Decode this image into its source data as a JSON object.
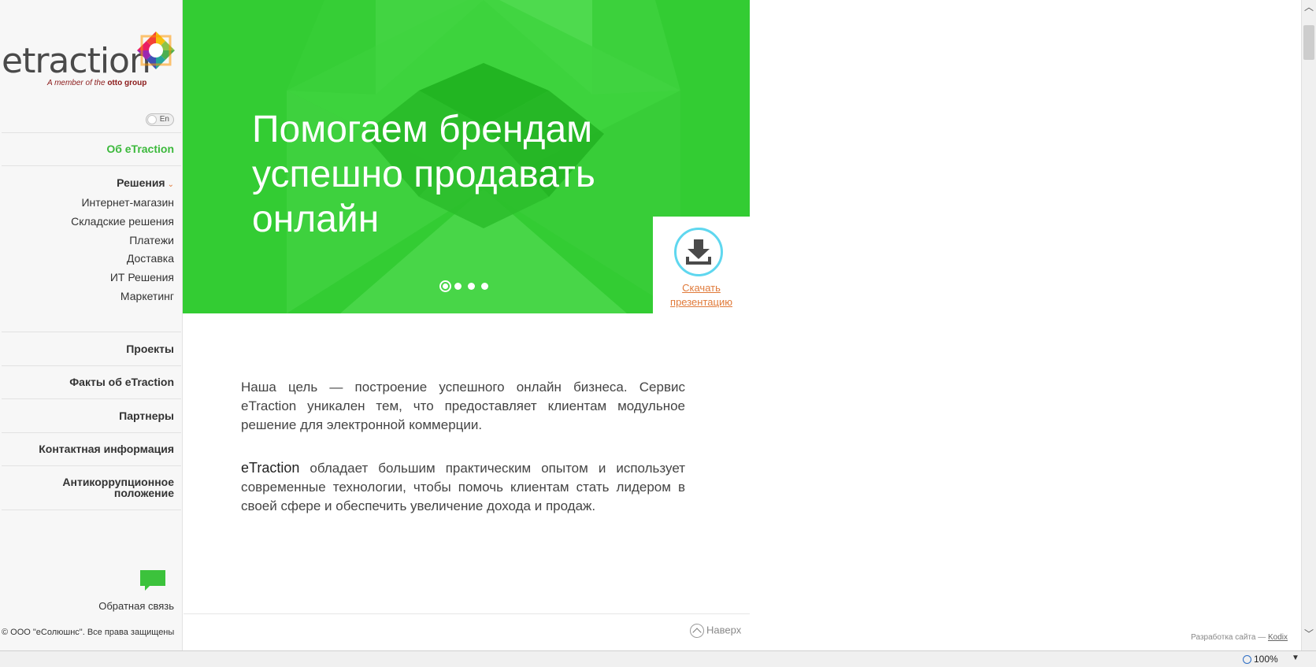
{
  "sidebar": {
    "logo_text": "etraction",
    "logo_tag_prefix": "A member of the ",
    "logo_tag_brand": "otto group",
    "lang_label": "En",
    "nav": {
      "about": "Об eTraction",
      "solutions": "Решения",
      "solutions_sub": [
        "Интернет-магазин",
        "Складские решения",
        "Платежи",
        "Доставка",
        "ИТ Решения",
        "Маркетинг"
      ],
      "projects": "Проекты",
      "facts": "Факты об eTraction",
      "partners": "Партнеры",
      "contacts": "Контактная информация",
      "anticorruption_line1": "Антикоррупционное",
      "anticorruption_line2": "положение"
    },
    "feedback_label": "Обратная связь",
    "copyright": "© ООО \"еСолюшнс\". Все права защищены"
  },
  "hero": {
    "title_lines": [
      "Помогаем брендам",
      "успешно продавать",
      "онлайн"
    ],
    "slides_count": 4,
    "active_slide": 1,
    "download_line1": "Скачать",
    "download_line2": "презентацию"
  },
  "content": {
    "paragraph1": "Наша цель — построение успешного онлайн бизнеса. Сервис eTraction уникален тем, что предоставляет клиентам модульное решение для электронной коммерции.",
    "paragraph2_brand": "eTraction",
    "paragraph2_rest": " обладает большим практическим опытом и использует современные технологии, чтобы помочь клиентам стать лидером в своей сфере и обеспечить увеличение дохода и продаж."
  },
  "footer": {
    "to_top": "Наверх",
    "dev_prefix": "Разработка сайта — ",
    "dev_link": "Kodix"
  },
  "browser": {
    "zoom": "100%"
  },
  "colors": {
    "accent_green": "#2fc72f",
    "link_orange": "#e07a3a",
    "ring_cyan": "#5fd7ef"
  }
}
